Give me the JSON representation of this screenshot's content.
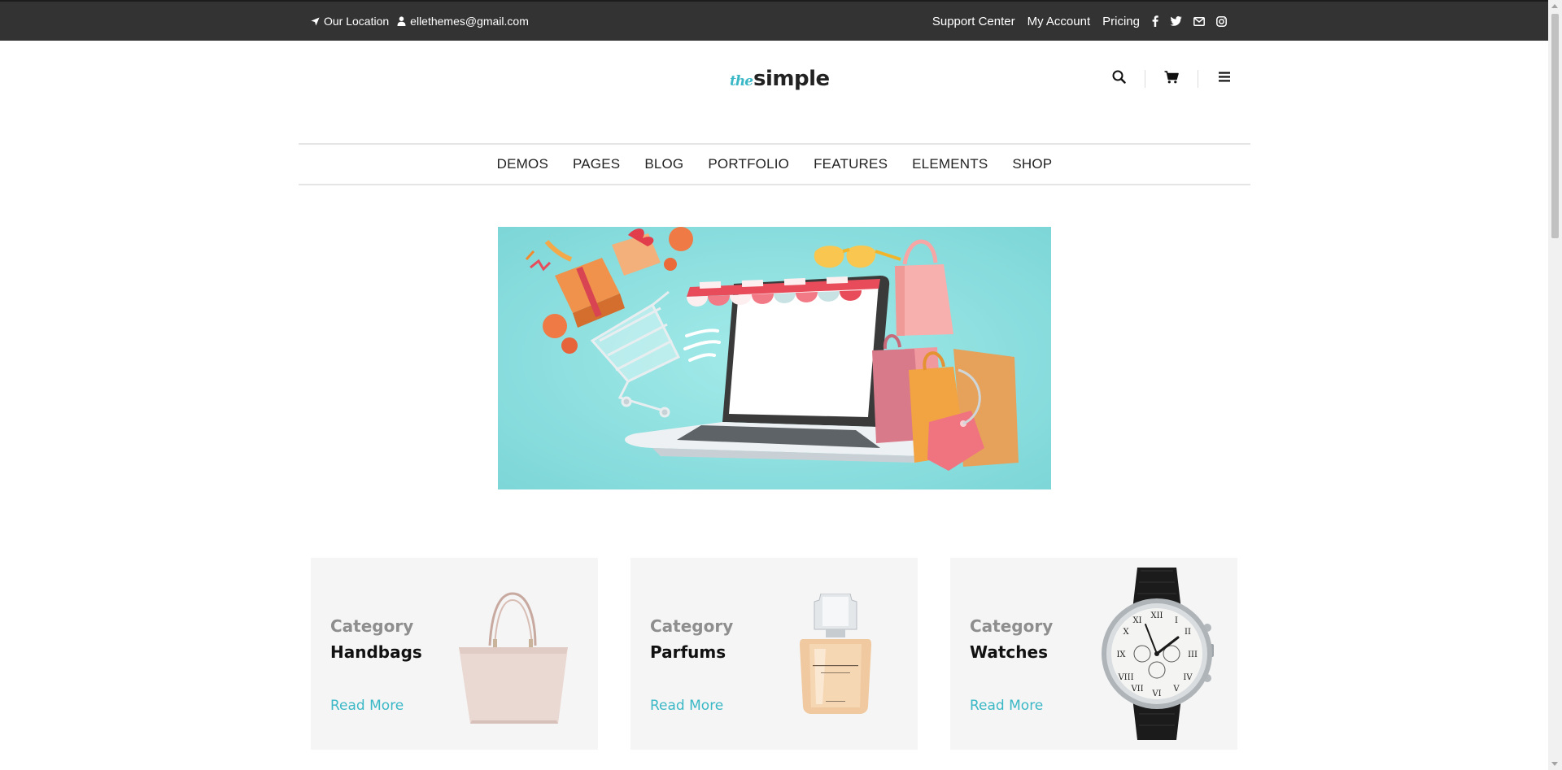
{
  "topbar": {
    "location": "Our Location",
    "email": "ellethemes@gmail.com",
    "links": [
      "Support Center",
      "My Account",
      "Pricing"
    ],
    "social_icons": [
      "facebook-icon",
      "twitter-icon",
      "mail-icon",
      "instagram-icon"
    ]
  },
  "logo": {
    "prefix": "the",
    "name": "simple"
  },
  "header_icons": [
    "search-icon",
    "cart-icon",
    "menu-icon"
  ],
  "nav": [
    "DEMOS",
    "PAGES",
    "BLOG",
    "PORTFOLIO",
    "FEATURES",
    "ELEMENTS",
    "SHOP"
  ],
  "colors": {
    "topbar_bg": "#333333",
    "accent": "#3bb8c6",
    "banner_bg": "#8fe0df",
    "card_bg": "#f5f5f5"
  },
  "categories": [
    {
      "label": "Category",
      "name": "Handbags",
      "link": "Read More",
      "image": "handbag"
    },
    {
      "label": "Category",
      "name": "Parfums",
      "link": "Read More",
      "image": "perfume-bottle"
    },
    {
      "label": "Category",
      "name": "Watches",
      "link": "Read More",
      "image": "wrist-watch"
    }
  ]
}
